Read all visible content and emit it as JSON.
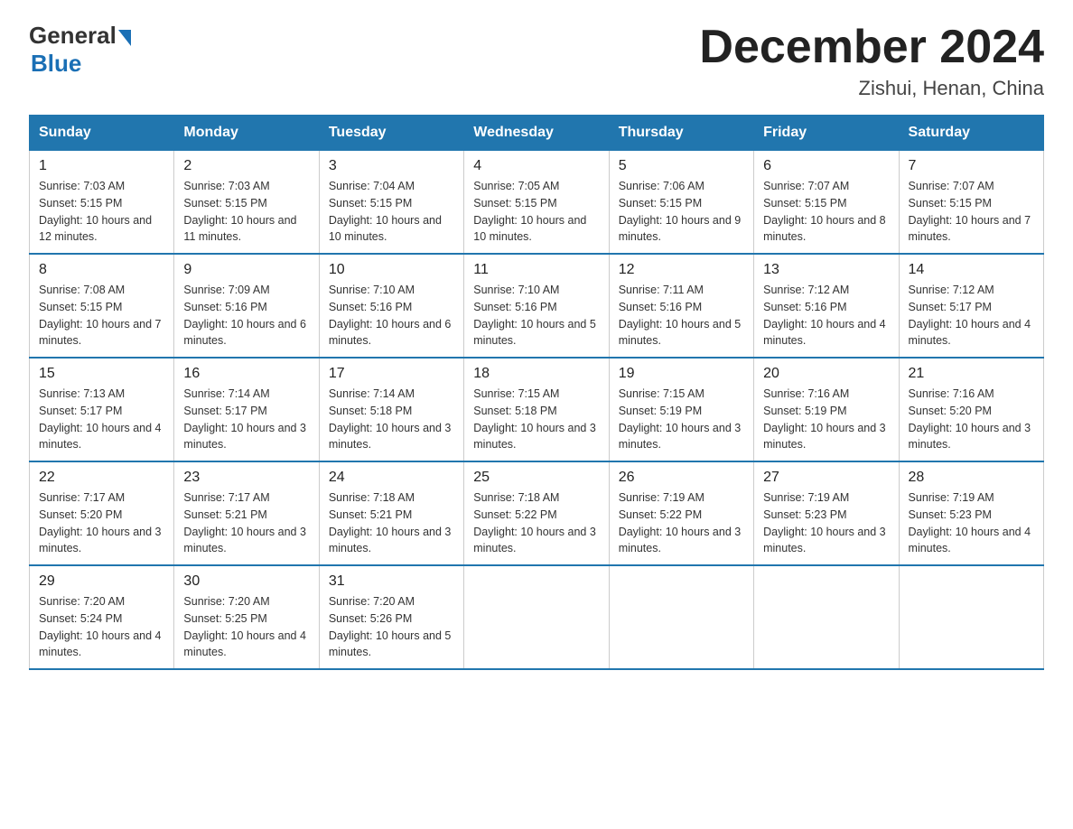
{
  "header": {
    "logo_general": "General",
    "logo_blue": "Blue",
    "month_title": "December 2024",
    "location": "Zishui, Henan, China"
  },
  "weekdays": [
    "Sunday",
    "Monday",
    "Tuesday",
    "Wednesday",
    "Thursday",
    "Friday",
    "Saturday"
  ],
  "weeks": [
    [
      {
        "day": "1",
        "sunrise": "7:03 AM",
        "sunset": "5:15 PM",
        "daylight": "10 hours and 12 minutes."
      },
      {
        "day": "2",
        "sunrise": "7:03 AM",
        "sunset": "5:15 PM",
        "daylight": "10 hours and 11 minutes."
      },
      {
        "day": "3",
        "sunrise": "7:04 AM",
        "sunset": "5:15 PM",
        "daylight": "10 hours and 10 minutes."
      },
      {
        "day": "4",
        "sunrise": "7:05 AM",
        "sunset": "5:15 PM",
        "daylight": "10 hours and 10 minutes."
      },
      {
        "day": "5",
        "sunrise": "7:06 AM",
        "sunset": "5:15 PM",
        "daylight": "10 hours and 9 minutes."
      },
      {
        "day": "6",
        "sunrise": "7:07 AM",
        "sunset": "5:15 PM",
        "daylight": "10 hours and 8 minutes."
      },
      {
        "day": "7",
        "sunrise": "7:07 AM",
        "sunset": "5:15 PM",
        "daylight": "10 hours and 7 minutes."
      }
    ],
    [
      {
        "day": "8",
        "sunrise": "7:08 AM",
        "sunset": "5:15 PM",
        "daylight": "10 hours and 7 minutes."
      },
      {
        "day": "9",
        "sunrise": "7:09 AM",
        "sunset": "5:16 PM",
        "daylight": "10 hours and 6 minutes."
      },
      {
        "day": "10",
        "sunrise": "7:10 AM",
        "sunset": "5:16 PM",
        "daylight": "10 hours and 6 minutes."
      },
      {
        "day": "11",
        "sunrise": "7:10 AM",
        "sunset": "5:16 PM",
        "daylight": "10 hours and 5 minutes."
      },
      {
        "day": "12",
        "sunrise": "7:11 AM",
        "sunset": "5:16 PM",
        "daylight": "10 hours and 5 minutes."
      },
      {
        "day": "13",
        "sunrise": "7:12 AM",
        "sunset": "5:16 PM",
        "daylight": "10 hours and 4 minutes."
      },
      {
        "day": "14",
        "sunrise": "7:12 AM",
        "sunset": "5:17 PM",
        "daylight": "10 hours and 4 minutes."
      }
    ],
    [
      {
        "day": "15",
        "sunrise": "7:13 AM",
        "sunset": "5:17 PM",
        "daylight": "10 hours and 4 minutes."
      },
      {
        "day": "16",
        "sunrise": "7:14 AM",
        "sunset": "5:17 PM",
        "daylight": "10 hours and 3 minutes."
      },
      {
        "day": "17",
        "sunrise": "7:14 AM",
        "sunset": "5:18 PM",
        "daylight": "10 hours and 3 minutes."
      },
      {
        "day": "18",
        "sunrise": "7:15 AM",
        "sunset": "5:18 PM",
        "daylight": "10 hours and 3 minutes."
      },
      {
        "day": "19",
        "sunrise": "7:15 AM",
        "sunset": "5:19 PM",
        "daylight": "10 hours and 3 minutes."
      },
      {
        "day": "20",
        "sunrise": "7:16 AM",
        "sunset": "5:19 PM",
        "daylight": "10 hours and 3 minutes."
      },
      {
        "day": "21",
        "sunrise": "7:16 AM",
        "sunset": "5:20 PM",
        "daylight": "10 hours and 3 minutes."
      }
    ],
    [
      {
        "day": "22",
        "sunrise": "7:17 AM",
        "sunset": "5:20 PM",
        "daylight": "10 hours and 3 minutes."
      },
      {
        "day": "23",
        "sunrise": "7:17 AM",
        "sunset": "5:21 PM",
        "daylight": "10 hours and 3 minutes."
      },
      {
        "day": "24",
        "sunrise": "7:18 AM",
        "sunset": "5:21 PM",
        "daylight": "10 hours and 3 minutes."
      },
      {
        "day": "25",
        "sunrise": "7:18 AM",
        "sunset": "5:22 PM",
        "daylight": "10 hours and 3 minutes."
      },
      {
        "day": "26",
        "sunrise": "7:19 AM",
        "sunset": "5:22 PM",
        "daylight": "10 hours and 3 minutes."
      },
      {
        "day": "27",
        "sunrise": "7:19 AM",
        "sunset": "5:23 PM",
        "daylight": "10 hours and 3 minutes."
      },
      {
        "day": "28",
        "sunrise": "7:19 AM",
        "sunset": "5:23 PM",
        "daylight": "10 hours and 4 minutes."
      }
    ],
    [
      {
        "day": "29",
        "sunrise": "7:20 AM",
        "sunset": "5:24 PM",
        "daylight": "10 hours and 4 minutes."
      },
      {
        "day": "30",
        "sunrise": "7:20 AM",
        "sunset": "5:25 PM",
        "daylight": "10 hours and 4 minutes."
      },
      {
        "day": "31",
        "sunrise": "7:20 AM",
        "sunset": "5:26 PM",
        "daylight": "10 hours and 5 minutes."
      },
      null,
      null,
      null,
      null
    ]
  ]
}
